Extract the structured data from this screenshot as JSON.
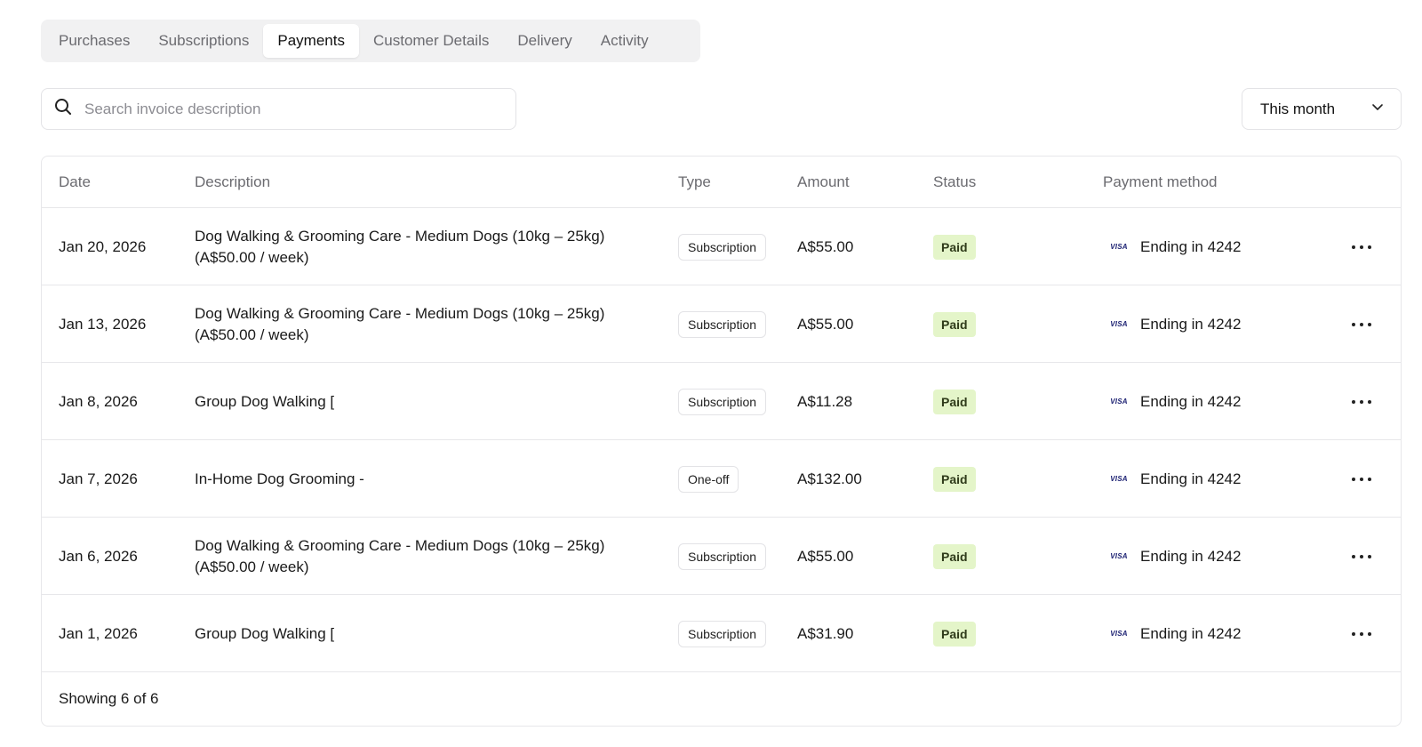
{
  "tabs": [
    {
      "label": "Purchases",
      "active": false
    },
    {
      "label": "Subscriptions",
      "active": false
    },
    {
      "label": "Payments",
      "active": true
    },
    {
      "label": "Customer Details",
      "active": false
    },
    {
      "label": "Delivery",
      "active": false
    },
    {
      "label": "Activity",
      "active": false
    }
  ],
  "search": {
    "placeholder": "Search invoice description",
    "value": "",
    "icon": "search-icon"
  },
  "period_filter": {
    "value": "This month",
    "icon": "chevron-down-icon"
  },
  "table": {
    "headers": {
      "date": "Date",
      "description": "Description",
      "type": "Type",
      "amount": "Amount",
      "status": "Status",
      "payment_method": "Payment method"
    },
    "rows": [
      {
        "date": "Jan 20, 2026",
        "description_line1": "Dog Walking & Grooming Care - Medium Dogs (10kg – 25kg)",
        "description_line2": "(A$50.00 / week)",
        "type": "Subscription",
        "amount": "A$55.00",
        "status": "Paid",
        "card_brand": "VISA",
        "payment_method": "Ending in 4242"
      },
      {
        "date": "Jan 13, 2026",
        "description_line1": "Dog Walking & Grooming Care - Medium Dogs (10kg – 25kg)",
        "description_line2": "(A$50.00 / week)",
        "type": "Subscription",
        "amount": "A$55.00",
        "status": "Paid",
        "card_brand": "VISA",
        "payment_method": "Ending in 4242"
      },
      {
        "date": "Jan 8, 2026",
        "description_line1": "Group Dog Walking [",
        "description_line2": "",
        "type": "Subscription",
        "amount": "A$11.28",
        "status": "Paid",
        "card_brand": "VISA",
        "payment_method": "Ending in 4242"
      },
      {
        "date": "Jan 7, 2026",
        "description_line1": "In-Home Dog Grooming -",
        "description_line2": "",
        "type": "One-off",
        "amount": "A$132.00",
        "status": "Paid",
        "card_brand": "VISA",
        "payment_method": "Ending in 4242"
      },
      {
        "date": "Jan 6, 2026",
        "description_line1": "Dog Walking & Grooming Care - Medium Dogs (10kg – 25kg)",
        "description_line2": "(A$50.00 / week)",
        "type": "Subscription",
        "amount": "A$55.00",
        "status": "Paid",
        "card_brand": "VISA",
        "payment_method": "Ending in 4242"
      },
      {
        "date": "Jan 1, 2026",
        "description_line1": "Group Dog Walking [",
        "description_line2": "",
        "type": "Subscription",
        "amount": "A$31.90",
        "status": "Paid",
        "card_brand": "VISA",
        "payment_method": "Ending in 4242"
      }
    ],
    "footer": "Showing 6 of 6"
  },
  "colors": {
    "paid_badge_bg": "#e4f5c9",
    "visa_blue": "#1a1f71",
    "border": "#e7e7ea"
  }
}
